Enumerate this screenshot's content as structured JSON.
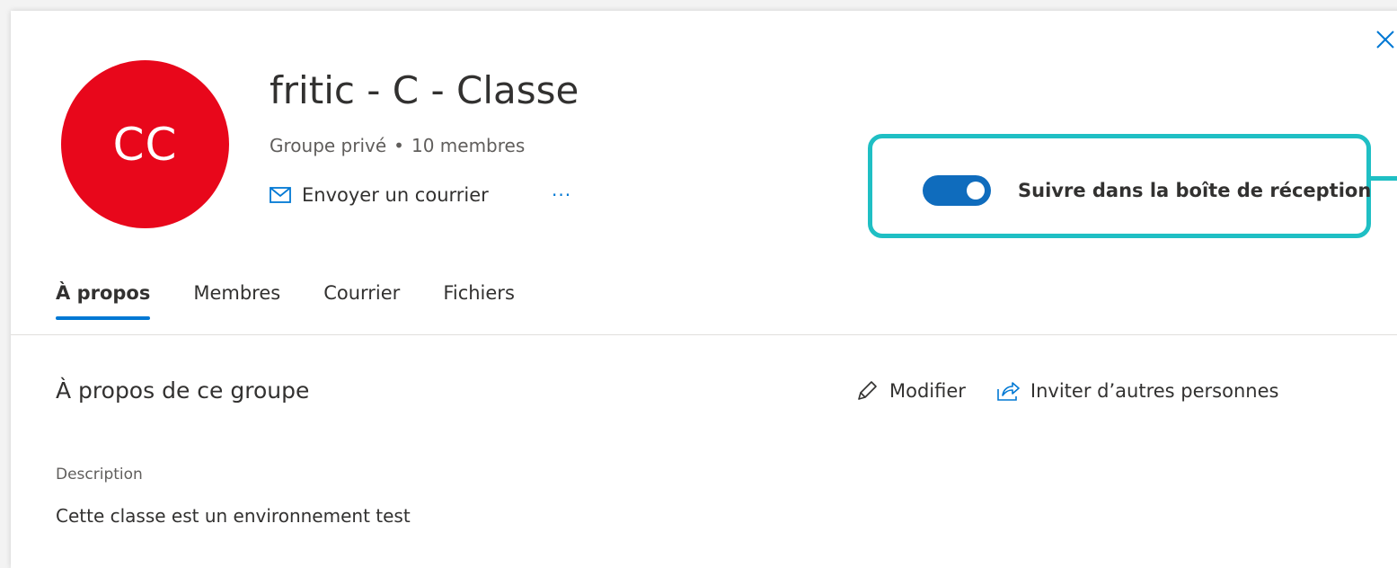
{
  "colors": {
    "accent": "#0078d4",
    "avatar_bg": "#e8071b",
    "toggle_on": "#0f6cbd",
    "highlight": "#1fbfc4"
  },
  "header": {
    "close_icon": "close-icon",
    "avatar_initials": "CC",
    "title": "fritic - C - Classe",
    "group_type": "Groupe privé",
    "separator": "•",
    "member_count": "10 membres",
    "send_mail_icon": "mail-icon",
    "send_mail_label": "Envoyer un courrier",
    "more_label": "···"
  },
  "follow": {
    "label": "Suivre dans la boîte de réception",
    "enabled": true
  },
  "tabs": [
    {
      "label": "À propos",
      "active": true
    },
    {
      "label": "Membres",
      "active": false
    },
    {
      "label": "Courrier",
      "active": false
    },
    {
      "label": "Fichiers",
      "active": false
    }
  ],
  "about": {
    "title": "À propos de ce groupe",
    "edit_icon": "pencil-icon",
    "edit_label": "Modifier",
    "invite_icon": "share-icon",
    "invite_label": "Inviter d’autres personnes",
    "description_label": "Description",
    "description_text": "Cette classe est un environnement test"
  }
}
